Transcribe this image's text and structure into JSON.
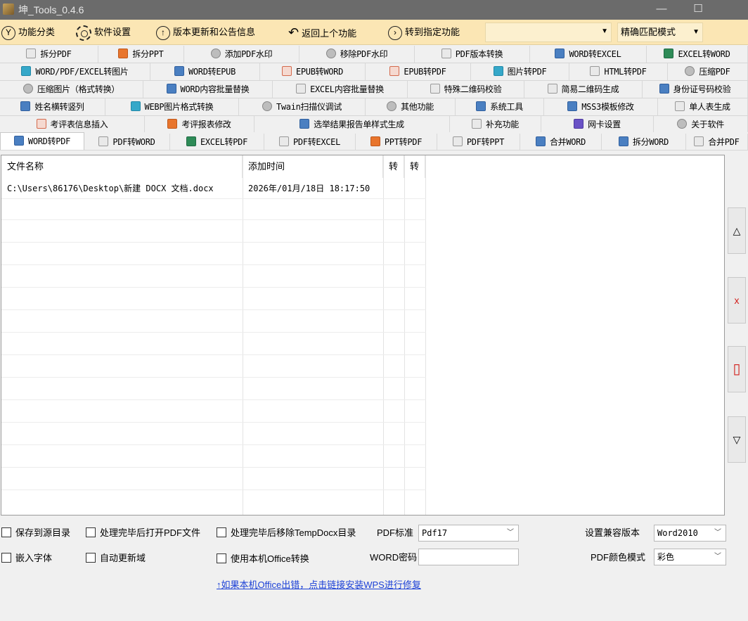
{
  "window": {
    "title": "坤_Tools_0.4.6",
    "minimize": "—",
    "maximize": "☐"
  },
  "toolbar": {
    "category": "功能分类",
    "settings": "软件设置",
    "updates": "版本更新和公告信息",
    "back": "返回上个功能",
    "goto": "转到指定功能",
    "search_value": "",
    "match_mode": "精确匹配模式"
  },
  "tabs_row1": [
    "拆分PDF",
    "拆分PPT",
    "添加PDF水印",
    "移除PDF水印",
    "PDF版本转换",
    "WORD转EXCEL",
    "EXCEL转WORD"
  ],
  "tabs_row2": [
    "WORD/PDF/EXCEL转图片",
    "WORD转EPUB",
    "EPUB转WORD",
    "EPUB转PDF",
    "图片转PDF",
    "HTML转PDF",
    "压缩PDF"
  ],
  "tabs_row3": [
    "压缩图片（格式转换）",
    "WORD内容批量替换",
    "EXCEL内容批量替换",
    "特殊二维码校验",
    "简易二维码生成",
    "身份证号码校验"
  ],
  "tabs_row4": [
    "姓名横转竖列",
    "WEBP图片格式转换",
    "Twain扫描仪调试",
    "其他功能",
    "系统工具",
    "MSS3模板修改",
    "单人表生成"
  ],
  "tabs_row5": [
    "考评表信息插入",
    "考评报表修改",
    "选举结果报告单样式生成",
    "补充功能",
    "网卡设置",
    "关于软件"
  ],
  "tabs_row6": [
    "WORD转PDF",
    "PDF转WORD",
    "EXCEL转PDF",
    "PDF转EXCEL",
    "PPT转PDF",
    "PDF转PPT",
    "合并WORD",
    "拆分WORD",
    "合并PDF"
  ],
  "grid": {
    "headers": [
      "文件名称",
      "添加时间",
      "转",
      "转"
    ],
    "rows": [
      {
        "file": "C:\\Users\\86176\\Desktop\\新建 DOCX 文档.docx",
        "time": "2026年/01月/18日 18:17:50"
      }
    ]
  },
  "side_buttons": [
    "△",
    "x",
    "▯",
    "▽"
  ],
  "options": {
    "save_to_source": "保存到源目录",
    "open_pdf_after": "处理完毕后打开PDF文件",
    "remove_tempdocx": "处理完毕后移除TempDocx目录",
    "pdf_standard_label": "PDF标准",
    "pdf_standard_value": "Pdf17",
    "compat_label": "设置兼容版本",
    "compat_value": "Word2010",
    "embed_fonts": "嵌入字体",
    "auto_update_fields": "自动更新域",
    "use_local_office": "使用本机Office转换",
    "word_password_label": "WORD密码",
    "word_password_value": "",
    "pdf_color_label": "PDF颜色模式",
    "pdf_color_value": "彩色"
  },
  "repair_link": "↑如果本机Office出错，点击链接安装WPS进行修复"
}
